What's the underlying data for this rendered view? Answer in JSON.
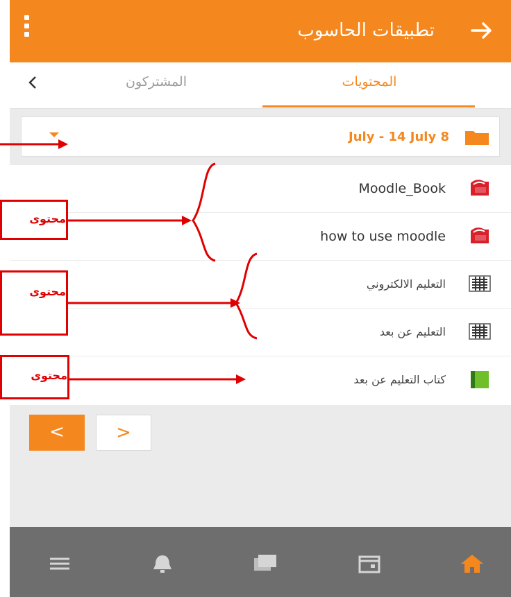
{
  "appbar": {
    "title": "تطبيقات الحاسوب"
  },
  "tabs": {
    "contents": "المحتويات",
    "participants": "المشتركون"
  },
  "section": {
    "label": "July - 14 July 8"
  },
  "items": [
    {
      "label": "Moodle_Book",
      "icon": "pdf-icon"
    },
    {
      "label": "how to use moodle",
      "icon": "pdf-icon"
    },
    {
      "label": "التعليم الالكتروني",
      "icon": "url-icon"
    },
    {
      "label": "التعليم عن بعد",
      "icon": "url-icon"
    },
    {
      "label": "كتاب التعليم عن بعد",
      "icon": "book-icon"
    }
  ],
  "pager": {
    "prev": "<",
    "next": ">"
  },
  "annotations": {
    "callout1": "محتوى",
    "callout2": "محتوى",
    "callout3": "محتوى"
  },
  "colors": {
    "accent": "#f5871f",
    "annotation": "#e00000",
    "nav": "#6e6e6e"
  }
}
